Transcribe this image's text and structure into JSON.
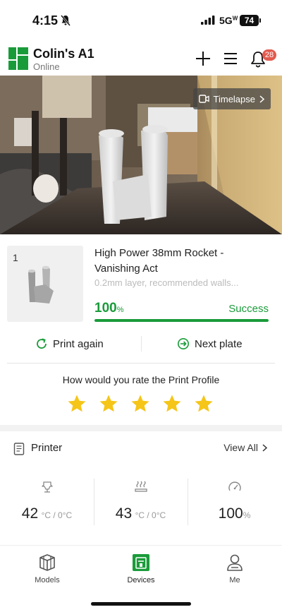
{
  "status_bar": {
    "time": "4:15",
    "network": "5G",
    "network_sup": "W",
    "battery": "74"
  },
  "header": {
    "device_name": "Colin's A1",
    "device_status": "Online",
    "notification_count": "28"
  },
  "camera": {
    "timelapse_label": "Timelapse"
  },
  "job": {
    "plate_number": "1",
    "title": "High Power 38mm Rocket - Vanishing Act",
    "subtitle": "0.2mm layer, recommended walls...",
    "progress_value": "100",
    "progress_unit": "%",
    "progress_fraction": 1.0,
    "status": "Success",
    "accent_color": "#1a9b3a"
  },
  "actions": {
    "print_again": "Print again",
    "next_plate": "Next plate"
  },
  "rating": {
    "prompt": "How would you rate the Print Profile",
    "stars_filled": 5,
    "stars_total": 5,
    "star_color": "#f5c518"
  },
  "printer": {
    "title": "Printer",
    "view_all": "View All",
    "nozzle": {
      "value": "42",
      "unit": "°C / 0°C"
    },
    "bed": {
      "value": "43",
      "unit": "°C / 0°C"
    },
    "fan": {
      "value": "100",
      "unit": "%"
    }
  },
  "tabs": {
    "models": "Models",
    "devices": "Devices",
    "me": "Me"
  }
}
